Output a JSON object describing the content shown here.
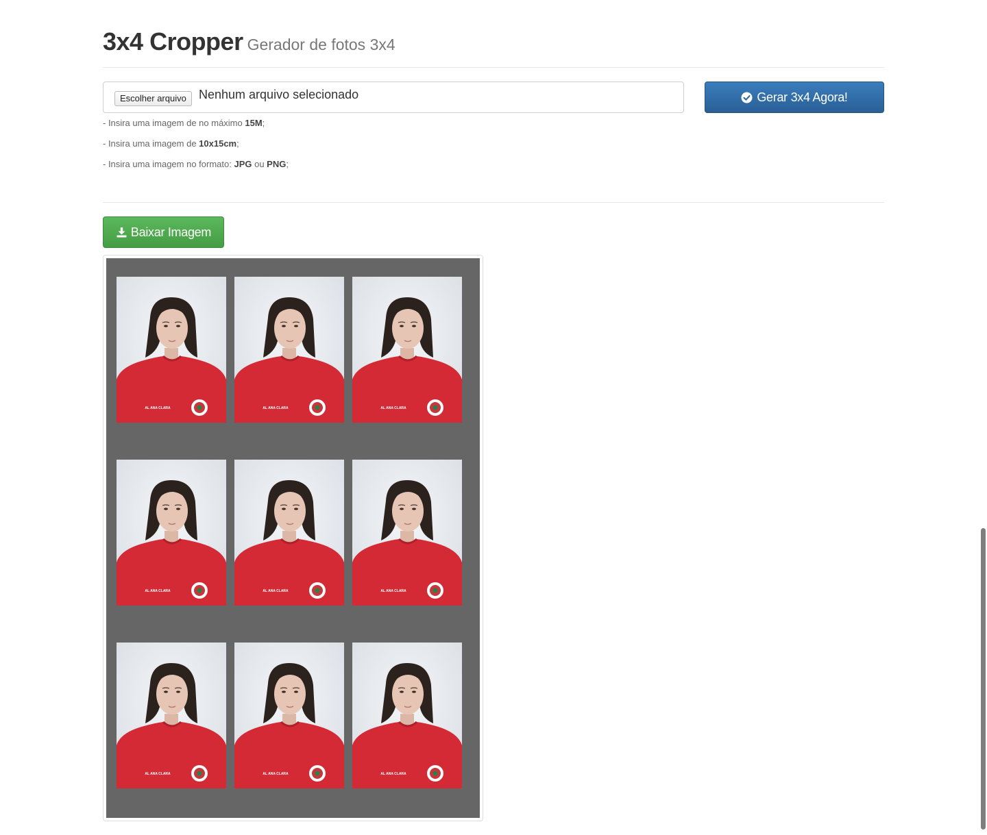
{
  "header": {
    "title": "3x4 Cropper",
    "subtitle": "Gerador de fotos 3x4"
  },
  "upload": {
    "button_label": "Escolher arquivo",
    "status": "Nenhum arquivo selecionado"
  },
  "generate_button": {
    "label": "Gerar 3x4 Agora!",
    "icon": "check-circle-icon"
  },
  "help": [
    {
      "prefix": "- Insira uma imagem de no máximo ",
      "strong": "15M",
      "suffix": ";"
    },
    {
      "prefix": "- Insira uma imagem de ",
      "strong": "10x15cm",
      "suffix": ";"
    },
    {
      "prefix": "- Insira uma imagem no formato: ",
      "strong": "JPG",
      "middle": " ou ",
      "strong2": "PNG",
      "suffix": ";"
    }
  ],
  "download_button": {
    "label": "Baixar Imagem",
    "icon": "download-icon"
  },
  "sheet": {
    "rows": 3,
    "columns": 3,
    "photo_caption": "AL ANA CLARA"
  },
  "colors": {
    "primary": "#337ab7",
    "success": "#5cb85c",
    "sheet_background": "#666666",
    "shirt": "#d42a35"
  }
}
